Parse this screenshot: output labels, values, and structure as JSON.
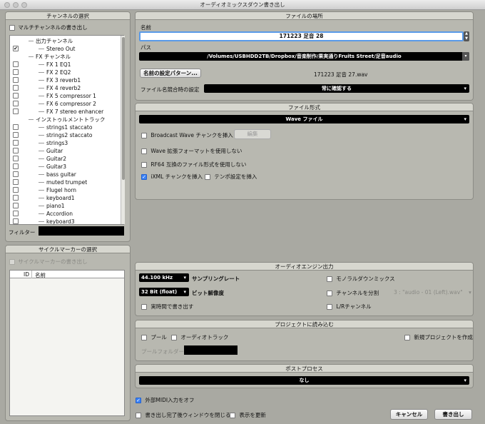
{
  "window": {
    "title": "オーディオミックスダウン書き出し"
  },
  "channel_select": {
    "header": "チャンネルの選択",
    "multi_channel_label": "マルチチャンネルの書き出し",
    "filter_label": "フィルター",
    "filter_value": "",
    "tree": [
      {
        "label": "出力チャンネル",
        "indent": 1,
        "checkbox": false,
        "checked": false
      },
      {
        "label": "Stereo Out",
        "indent": 2,
        "checkbox": true,
        "checked": true
      },
      {
        "label": "FX チャンネル",
        "indent": 1,
        "checkbox": false,
        "checked": false
      },
      {
        "label": "FX 1   EQ1",
        "indent": 2,
        "checkbox": true,
        "checked": false
      },
      {
        "label": "FX 2   EQ2",
        "indent": 2,
        "checkbox": true,
        "checked": false
      },
      {
        "label": "FX 3   reverb1",
        "indent": 2,
        "checkbox": true,
        "checked": false
      },
      {
        "label": "FX 4   reverb2",
        "indent": 2,
        "checkbox": true,
        "checked": false
      },
      {
        "label": "FX 5   compressor 1",
        "indent": 2,
        "checkbox": true,
        "checked": false
      },
      {
        "label": "FX 6   compressor 2",
        "indent": 2,
        "checkbox": true,
        "checked": false
      },
      {
        "label": "FX 7   stereo enhancer",
        "indent": 2,
        "checkbox": true,
        "checked": false
      },
      {
        "label": "インストゥルメントトラック",
        "indent": 1,
        "checkbox": false,
        "checked": false
      },
      {
        "label": "strings1 staccato",
        "indent": 2,
        "checkbox": true,
        "checked": false
      },
      {
        "label": "strings2 staccato",
        "indent": 2,
        "checkbox": true,
        "checked": false
      },
      {
        "label": "strings3",
        "indent": 2,
        "checkbox": true,
        "checked": false
      },
      {
        "label": "Guitar",
        "indent": 2,
        "checkbox": true,
        "checked": false
      },
      {
        "label": "Guitar2",
        "indent": 2,
        "checkbox": true,
        "checked": false
      },
      {
        "label": "Guitar3",
        "indent": 2,
        "checkbox": true,
        "checked": false
      },
      {
        "label": "bass guitar",
        "indent": 2,
        "checkbox": true,
        "checked": false
      },
      {
        "label": "muted trumpet",
        "indent": 2,
        "checkbox": true,
        "checked": false
      },
      {
        "label": "Flugel horn",
        "indent": 2,
        "checkbox": true,
        "checked": false
      },
      {
        "label": "keyboard1",
        "indent": 2,
        "checkbox": true,
        "checked": false
      },
      {
        "label": "piano1",
        "indent": 2,
        "checkbox": true,
        "checked": false
      },
      {
        "label": "Accordion",
        "indent": 2,
        "checkbox": true,
        "checked": false
      },
      {
        "label": "keyboard3",
        "indent": 2,
        "checkbox": true,
        "checked": false
      }
    ]
  },
  "cycle_marker": {
    "header": "サイクルマーカーの選択",
    "export_label": "サイクルマーカーの書き出し",
    "col_id": "ID",
    "col_name": "名前"
  },
  "file_location": {
    "header": "ファイルの場所",
    "name_label": "名前",
    "name_value": "171223 足音 28",
    "path_label": "パス",
    "path_value": "/Volumes/USBHDD2TB/Dropbox/音楽制作/果実通りFruits Street/足音audio",
    "naming_button": "名前の設定パターン...",
    "filename_preview": "171223 足音 27.wav",
    "conflict_label": "ファイル名競合時の設定",
    "conflict_value": "常に確認する"
  },
  "file_format": {
    "header": "ファイル形式",
    "format_value": "Wave ファイル",
    "broadcast_wave": "Broadcast Wave チャンクを挿入",
    "edit_button": "編集",
    "no_extended": "Wave 拡張フォーマットを使用しない",
    "rf64": "RF64 互換のファイル形式を使用しない",
    "ixml": "iXML チャンクを挿入",
    "tempo": "テンポ設定を挿入"
  },
  "audio_engine": {
    "header": "オーディオエンジン出力",
    "sample_rate_value": "44.100 kHz",
    "sample_rate_label": "サンプリングレート",
    "bit_depth_value": "32 Bit (float)",
    "bit_depth_label": "ビット解像度",
    "realtime_label": "実時間で書き出す",
    "mono_downmix": "モノラルダウンミックス",
    "split_channels": "チャンネルを分割",
    "split_value": "3 : \"audio - 01 (Left).wav\"",
    "lr_channel": "L/Rチャンネル"
  },
  "import_project": {
    "header": "プロジェクトに読み込む",
    "pool": "プール",
    "audio_track": "オーディオトラック",
    "new_project": "新規プロジェクトを作成",
    "pool_folder_label": "プールフォルダー"
  },
  "post_process": {
    "header": "ポストプロセス",
    "value": "なし"
  },
  "footer": {
    "disable_midi": "外部MIDI入力をオフ",
    "close_window": "書き出し完了後ウィンドウを閉じる",
    "update_display": "表示を更新",
    "cancel": "キャンセル",
    "export": "書き出し"
  },
  "colors": {
    "accent": "#3b82f6",
    "panel": "#b8b8b0",
    "field_dark": "#000000"
  }
}
